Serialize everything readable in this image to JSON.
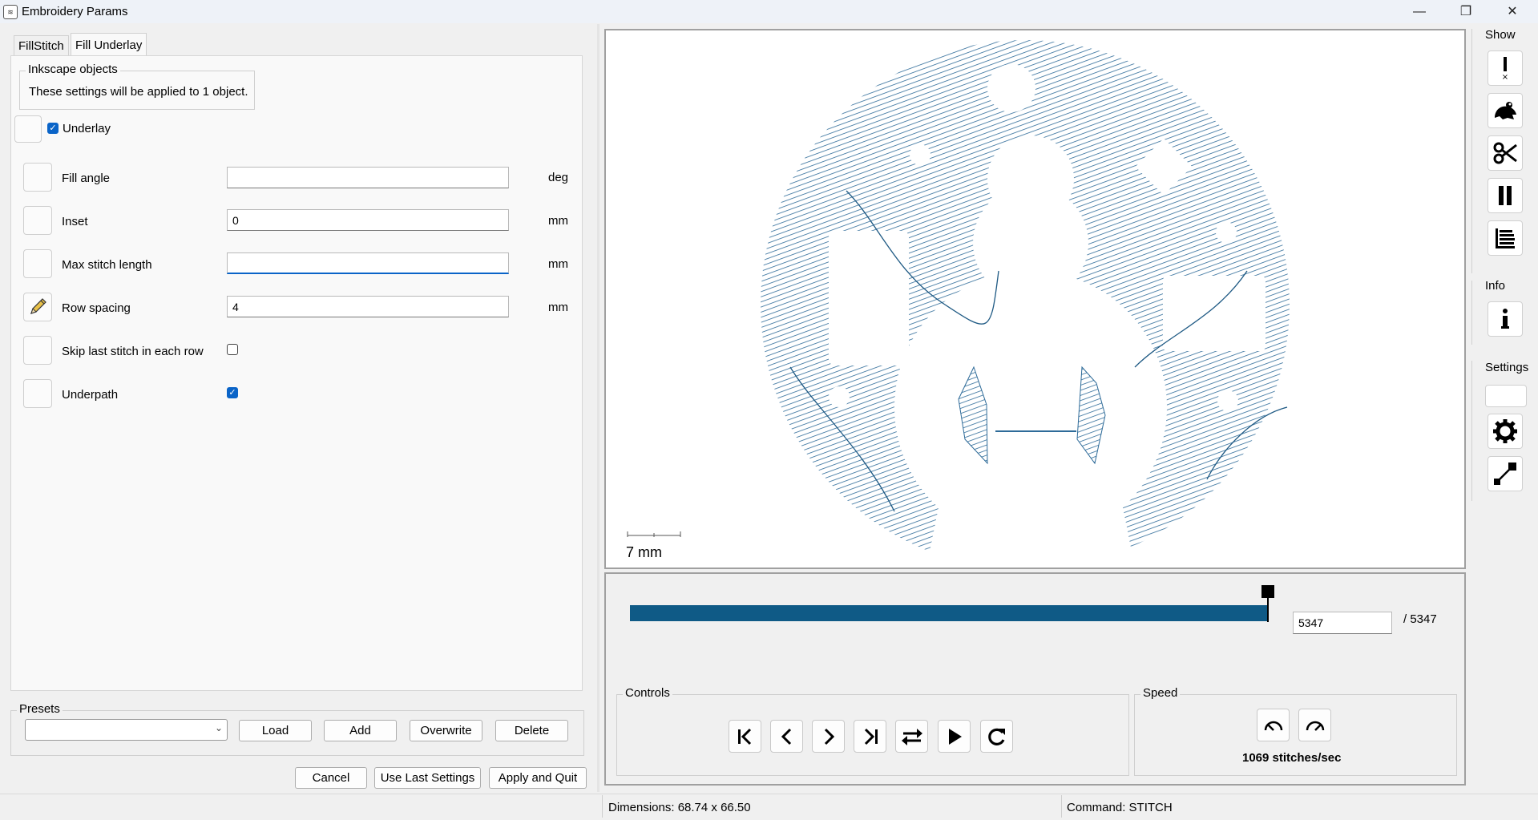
{
  "window": {
    "title": "Embroidery Params",
    "icon": "ink-icon"
  },
  "tabs": [
    {
      "label": "FillStitch",
      "active": false
    },
    {
      "label": "Fill Underlay",
      "active": true
    }
  ],
  "inkscape_objects": {
    "legend": "Inkscape objects",
    "text": "These settings will be applied to 1 object."
  },
  "underlay_toggle": {
    "label": "Underlay",
    "checked": true
  },
  "params": [
    {
      "label": "Fill angle",
      "value": "",
      "unit": "deg",
      "type": "text"
    },
    {
      "label": "Inset",
      "value": "0",
      "unit": "mm",
      "type": "text"
    },
    {
      "label": "Max stitch length",
      "value": "",
      "unit": "mm",
      "type": "text",
      "focused": true
    },
    {
      "label": "Row spacing",
      "value": "4",
      "unit": "mm",
      "type": "text",
      "modified": true
    },
    {
      "label": "Skip last stitch in each row",
      "type": "checkbox",
      "checked": false
    },
    {
      "label": "Underpath",
      "type": "checkbox",
      "checked": true
    }
  ],
  "presets": {
    "legend": "Presets",
    "selected": "",
    "buttons": {
      "load": "Load",
      "add": "Add",
      "overwrite": "Overwrite",
      "delete": "Delete"
    }
  },
  "footer_buttons": {
    "cancel": "Cancel",
    "use_last": "Use Last Settings",
    "apply_quit": "Apply and Quit"
  },
  "preview": {
    "scale_label": "7 mm",
    "stitch_color": "#2e6b99"
  },
  "slider": {
    "current": "5347",
    "total_label": "/ 5347",
    "fraction": 1.0,
    "color": "#0f5a86"
  },
  "controls": {
    "legend": "Controls",
    "buttons": [
      "first-stitch-icon",
      "previous-stitch-icon",
      "next-stitch-icon",
      "last-stitch-icon",
      "swap-direction-icon",
      "play-icon",
      "restart-icon"
    ]
  },
  "speed": {
    "legend": "Speed",
    "text": "1069 stitches/sec"
  },
  "sidebar": {
    "show_label": "Show",
    "info_label": "Info",
    "settings_label": "Settings"
  },
  "status": {
    "dimensions": "Dimensions: 68.74 x 66.50",
    "command": "Command: STITCH"
  },
  "accent": "#0a64c8"
}
